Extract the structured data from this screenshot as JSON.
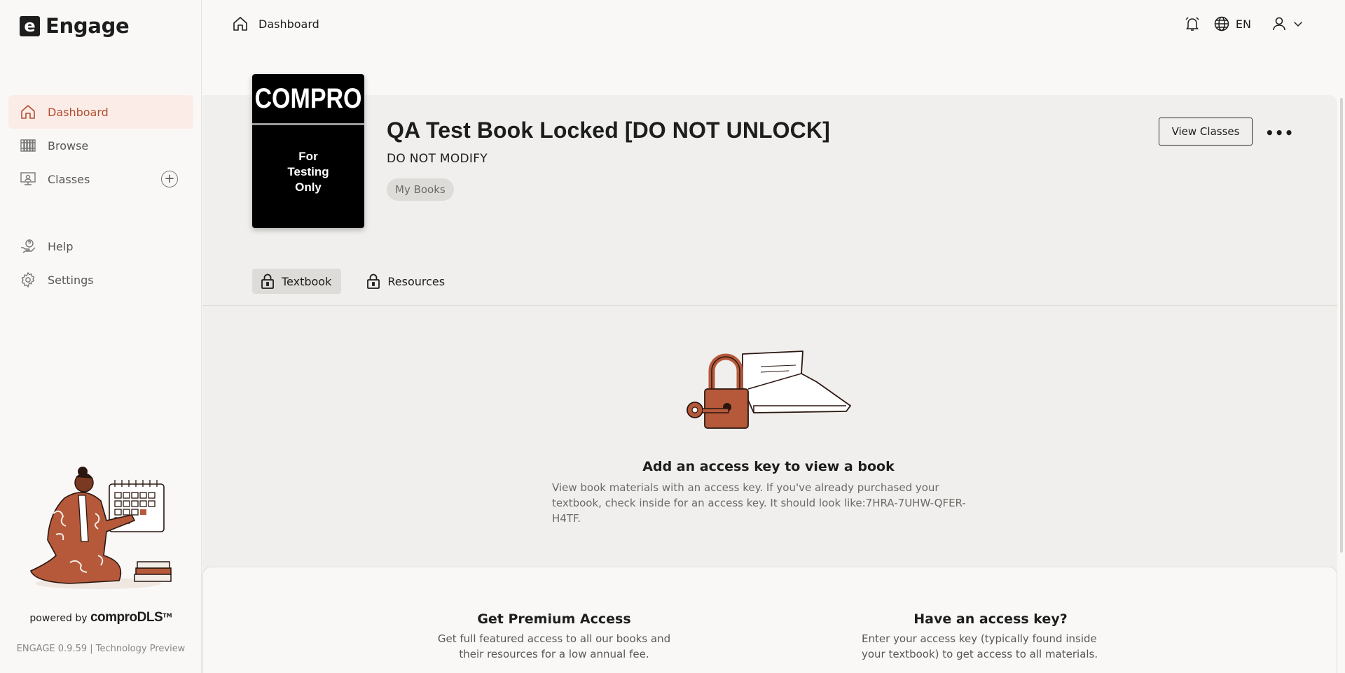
{
  "app": {
    "brand_mark": "e",
    "brand_name": "Engage"
  },
  "sidebar": {
    "items": [
      {
        "label": "Dashboard",
        "icon": "home-icon"
      },
      {
        "label": "Browse",
        "icon": "browse-icon"
      },
      {
        "label": "Classes",
        "icon": "classes-icon",
        "action_icon": "add-circle-icon"
      },
      {
        "label": "Help",
        "icon": "help-icon"
      },
      {
        "label": "Settings",
        "icon": "gear-icon"
      }
    ],
    "powered_prefix": "powered by",
    "powered_brand": "comproDLS",
    "powered_tm": "TM",
    "version": "ENGAGE 0.9.59 | Technology Preview"
  },
  "topbar": {
    "breadcrumb": "Dashboard",
    "language": "EN"
  },
  "book": {
    "cover_title": "COMPRO",
    "cover_subtitle": "For\nTesting\nOnly",
    "title": "QA Test Book Locked [DO NOT UNLOCK]",
    "subtitle": "DO NOT MODIFY",
    "tag": "My Books",
    "view_classes_label": "View Classes",
    "more_label": "•••"
  },
  "tabs": [
    {
      "label": "Textbook",
      "active": true,
      "icon": "lock-icon"
    },
    {
      "label": "Resources",
      "active": false,
      "icon": "lock-icon"
    }
  ],
  "empty_state": {
    "title": "Add an access key to view a book",
    "description": "View book materials with an access key. If you've already purchased your textbook, check inside for an access key. It should look like:7HRA-7UHW-QFER-H4TF."
  },
  "cards": {
    "premium": {
      "title": "Get Premium Access",
      "description": "Get full featured access to all our books and their resources for a low annual fee."
    },
    "access_key": {
      "title": "Have an access key?",
      "description": "Enter your access key (typically found inside your textbook) to get access to all materials."
    }
  },
  "colors": {
    "accent": "#b24e2f",
    "active_bg": "#fbece7",
    "panel_bg": "#f0efed",
    "page_bg": "#f9f8f6"
  }
}
